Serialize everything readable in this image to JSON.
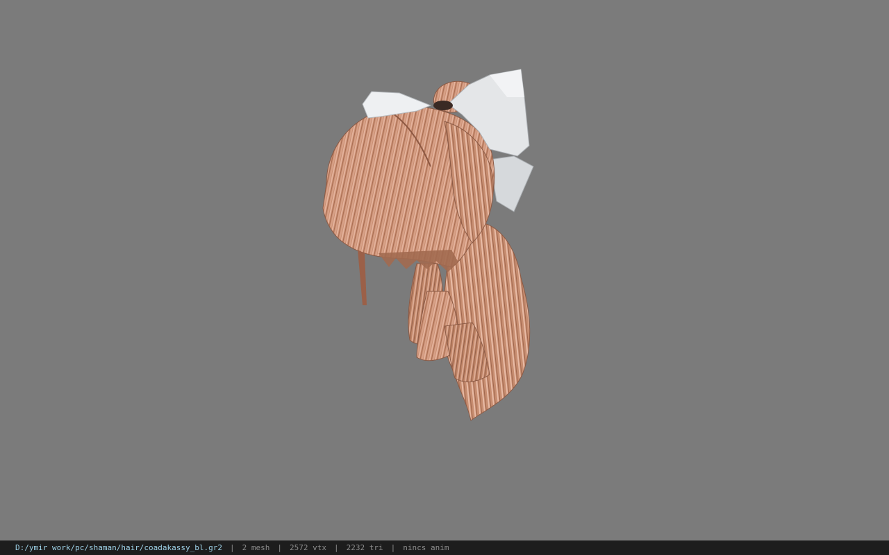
{
  "viewport": {
    "background": "#7b7b7b",
    "model": "hair-model",
    "hair_color": "#c98f72",
    "bow_color": "#e6e8ea"
  },
  "status": {
    "path": "D:/ymir work/pc/shaman/hair/coadakassy_bl.gr2",
    "separator": "|",
    "mesh": "2 mesh",
    "vtx": "2572 vtx",
    "tri": "2232 tri",
    "anim": "nincs anim"
  }
}
